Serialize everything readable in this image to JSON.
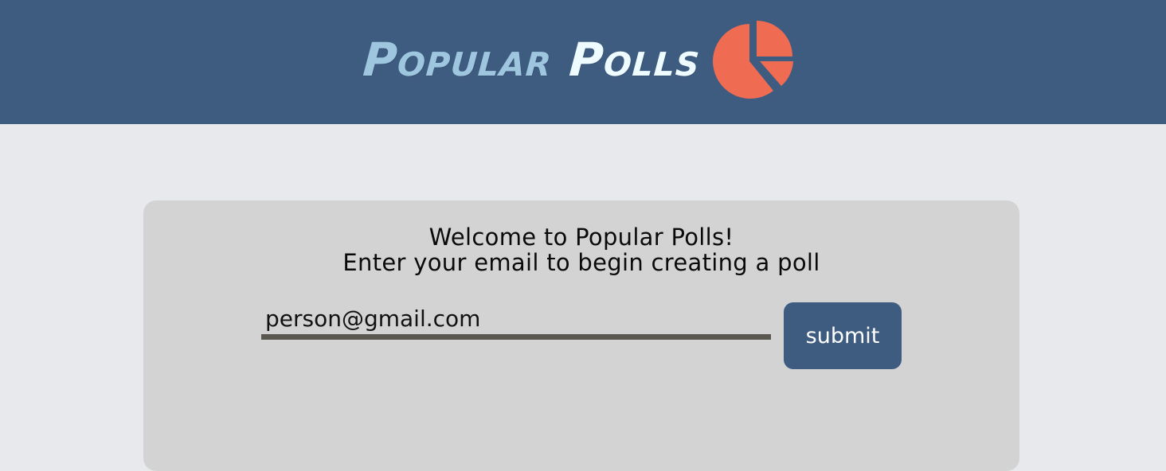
{
  "header": {
    "brand_word_1": "Popular",
    "brand_word_2": "Polls",
    "logo_icon": "pie-chart-icon",
    "background_color": "#3e5b80",
    "logo_color": "#ef6c52"
  },
  "main": {
    "welcome_line_1": "Welcome to Popular Polls!",
    "welcome_line_2": "Enter your email to begin creating a poll",
    "email_value": "person@gmail.com",
    "submit_label": "submit"
  }
}
